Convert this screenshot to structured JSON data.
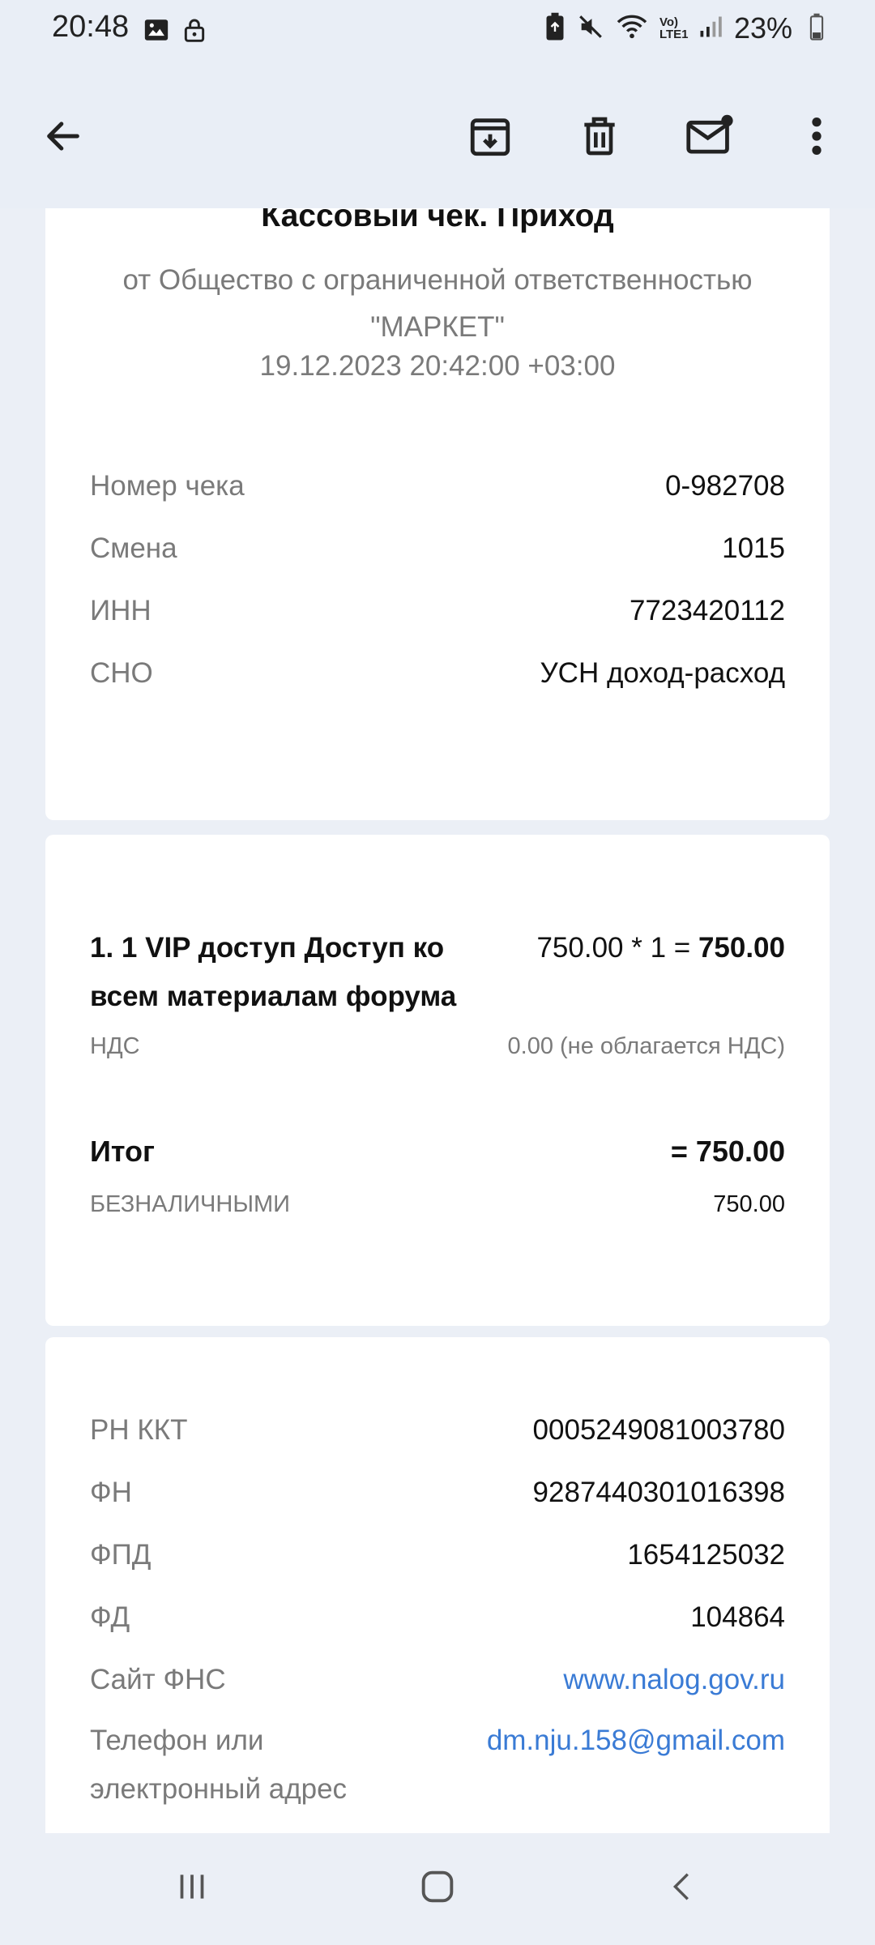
{
  "status_bar": {
    "time": "20:48",
    "battery_percent": "23%",
    "network_label": "Vo) LTE1"
  },
  "toolbar": {
    "back_icon": "arrow-left-icon",
    "archive_icon": "archive-icon",
    "delete_icon": "trash-icon",
    "mark_unread_icon": "mail-unread-icon",
    "more_icon": "more-vert-icon"
  },
  "receipt": {
    "title": "Кассовый чек. Приход",
    "from": "от Общество с ограниченной ответственностью \"МАРКЕТ\"",
    "datetime": "19.12.2023 20:42:00 +03:00",
    "header_rows": [
      {
        "label": "Номер чека",
        "value": "0-982708"
      },
      {
        "label": "Смена",
        "value": "1015"
      },
      {
        "label": "ИНН",
        "value": "7723420112"
      },
      {
        "label": "СНО",
        "value": "УСН доход-расход"
      }
    ],
    "item": {
      "name": "1. 1 VIP доступ Доступ ко всем материалам форума",
      "price_expr": "750.00 * 1 = ",
      "price_total": "750.00",
      "vat_label": "НДС",
      "vat_value": "0.00 (не облагается НДС)"
    },
    "total": {
      "label": "Итог",
      "value": "= 750.00",
      "payment_label": "БЕЗНАЛИЧНЫМИ",
      "payment_value": "750.00"
    },
    "fiscal_rows": [
      {
        "label": "РН ККТ",
        "value": "0005249081003780"
      },
      {
        "label": "ФН",
        "value": "9287440301016398"
      },
      {
        "label": "ФПД",
        "value": "1654125032"
      },
      {
        "label": "ФД",
        "value": "104864"
      },
      {
        "label": "Сайт ФНС",
        "value": "www.nalog.gov.ru"
      }
    ],
    "contact": {
      "label": "Телефон или электронный адрес",
      "value": "dm.nju.158@gmail.com"
    }
  },
  "nav_bar": {
    "recents_icon": "recents-icon",
    "home_icon": "home-icon",
    "back_icon": "nav-back-icon"
  },
  "colors": {
    "background": "#ebeff6",
    "card": "#ffffff",
    "link": "#3a7bd5",
    "muted_text": "#7a7a7a"
  }
}
